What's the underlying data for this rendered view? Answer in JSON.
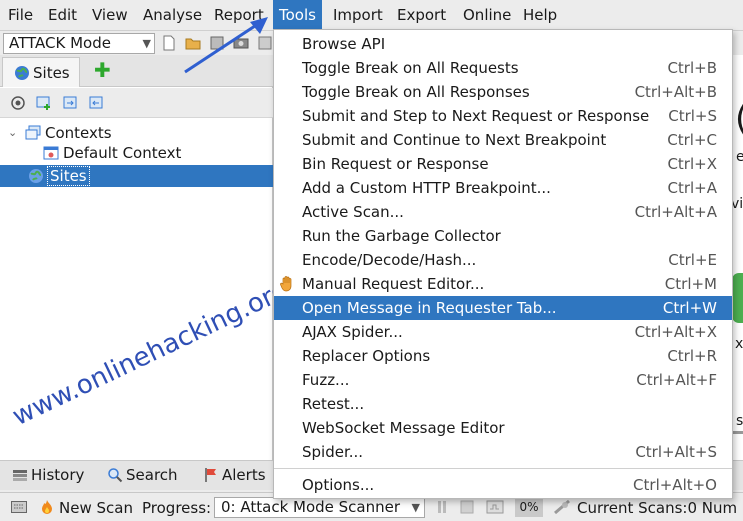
{
  "menubar": {
    "items": [
      "File",
      "Edit",
      "View",
      "Analyse",
      "Report",
      "Tools",
      "Import",
      "Export",
      "Online",
      "Help"
    ],
    "active": "Tools"
  },
  "toolbar": {
    "mode": "ATTACK Mode"
  },
  "sites_panel": {
    "tab_label": "Sites",
    "tree": {
      "contexts": "Contexts",
      "default_context": "Default Context",
      "sites": "Sites"
    }
  },
  "watermark": "www.onlinehacking.org",
  "right_content": {
    "fragments": [
      "(",
      "e",
      "vit",
      "x",
      "s"
    ]
  },
  "bottom_tabs": [
    "History",
    "Search",
    "Alerts"
  ],
  "statusbar": {
    "new_scan": "New Scan",
    "progress_label": "Progress:",
    "progress_value": "0: Attack Mode Scanner",
    "percent": "0%",
    "current_scans": "Current Scans:0 Num"
  },
  "tools_menu": [
    {
      "label": "Browse API",
      "shortcut": ""
    },
    {
      "label": "Toggle Break on All Requests",
      "shortcut": "Ctrl+B"
    },
    {
      "label": "Toggle Break on All Responses",
      "shortcut": "Ctrl+Alt+B"
    },
    {
      "label": "Submit and Step to Next Request or Response",
      "shortcut": "Ctrl+S"
    },
    {
      "label": "Submit and Continue to Next Breakpoint",
      "shortcut": "Ctrl+C"
    },
    {
      "label": "Bin Request or Response",
      "shortcut": "Ctrl+X"
    },
    {
      "label": "Add a Custom HTTP Breakpoint...",
      "shortcut": "Ctrl+A"
    },
    {
      "label": "Active Scan...",
      "shortcut": "Ctrl+Alt+A"
    },
    {
      "label": "Run the Garbage Collector",
      "shortcut": ""
    },
    {
      "label": "Encode/Decode/Hash...",
      "shortcut": "Ctrl+E"
    },
    {
      "label": "Manual Request Editor...",
      "shortcut": "Ctrl+M"
    },
    {
      "label": "Open Message in Requester Tab...",
      "shortcut": "Ctrl+W"
    },
    {
      "label": "AJAX Spider...",
      "shortcut": "Ctrl+Alt+X"
    },
    {
      "label": "Replacer Options",
      "shortcut": "Ctrl+R"
    },
    {
      "label": "Fuzz...",
      "shortcut": "Ctrl+Alt+F"
    },
    {
      "label": "Retest...",
      "shortcut": ""
    },
    {
      "label": "WebSocket Message Editor",
      "shortcut": ""
    },
    {
      "label": "Spider...",
      "shortcut": "Ctrl+Alt+S"
    },
    {
      "label": "Options...",
      "shortcut": "Ctrl+Alt+O"
    }
  ],
  "colors": {
    "accent": "#2f76c0",
    "watermark": "#2f4fb5",
    "plus": "#2da82d"
  }
}
